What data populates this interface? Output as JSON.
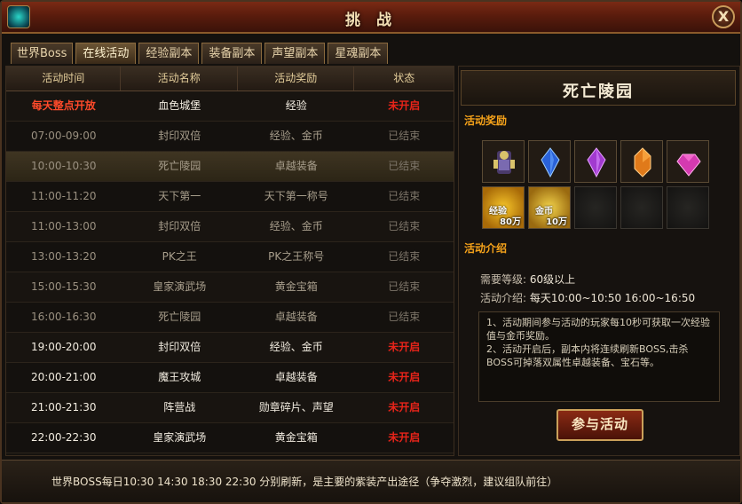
{
  "window": {
    "title": "挑 战",
    "close_label": "X"
  },
  "tabs": [
    {
      "label": "世界Boss",
      "active": false
    },
    {
      "label": "在线活动",
      "active": true
    },
    {
      "label": "经验副本",
      "active": false
    },
    {
      "label": "装备副本",
      "active": false
    },
    {
      "label": "声望副本",
      "active": false
    },
    {
      "label": "星魂副本",
      "active": false
    }
  ],
  "table": {
    "headers": [
      "活动时间",
      "活动名称",
      "活动奖励",
      "状态"
    ],
    "rows": [
      {
        "time": "每天整点开放",
        "name": "血色城堡",
        "reward": "经验",
        "status": "未开启"
      },
      {
        "time": "07:00-09:00",
        "name": "封印双倍",
        "reward": "经验、金币",
        "status": "已结束"
      },
      {
        "time": "10:00-10:30",
        "name": "死亡陵园",
        "reward": "卓越装备",
        "status": "已结束"
      },
      {
        "time": "11:00-11:20",
        "name": "天下第一",
        "reward": "天下第一称号",
        "status": "已结束"
      },
      {
        "time": "11:00-13:00",
        "name": "封印双倍",
        "reward": "经验、金币",
        "status": "已结束"
      },
      {
        "time": "13:00-13:20",
        "name": "PK之王",
        "reward": "PK之王称号",
        "status": "已结束"
      },
      {
        "time": "15:00-15:30",
        "name": "皇家演武场",
        "reward": "黄金宝箱",
        "status": "已结束"
      },
      {
        "time": "16:00-16:30",
        "name": "死亡陵园",
        "reward": "卓越装备",
        "status": "已结束"
      },
      {
        "time": "19:00-20:00",
        "name": "封印双倍",
        "reward": "经验、金币",
        "status": "未开启"
      },
      {
        "time": "20:00-21:00",
        "name": "魔王攻城",
        "reward": "卓越装备",
        "status": "未开启"
      },
      {
        "time": "21:00-21:30",
        "name": "阵营战",
        "reward": "勋章碎片、声望",
        "status": "未开启"
      },
      {
        "time": "22:00-22:30",
        "name": "皇家演武场",
        "reward": "黄金宝箱",
        "status": "未开启"
      }
    ]
  },
  "detail": {
    "title": "死亡陵园",
    "reward_section": "活动奖励",
    "rewards": [
      {
        "icon": "armor-set-icon",
        "color": "#7a6ab0"
      },
      {
        "icon": "blue-crystal-icon",
        "color": "#2a62d8"
      },
      {
        "icon": "purple-crystal-icon",
        "color": "#a23ad0"
      },
      {
        "icon": "orange-crystal-icon",
        "color": "#e07a1a"
      },
      {
        "icon": "pink-gem-icon",
        "color": "#d43ab0"
      },
      {
        "icon": "exp-icon",
        "label": "经验",
        "qty": "80万"
      },
      {
        "icon": "gold-coin-icon",
        "label": "金币",
        "qty": "10万"
      }
    ],
    "intro_section": "活动介绍",
    "level_label": "需要等级:",
    "level_value": "60级以上",
    "intro_label": "活动介绍:",
    "intro_value": "每天10:00~10:50  16:00~16:50",
    "desc_line1": "1、活动期间参与活动的玩家每10秒可获取一次经验值与金币奖励。",
    "desc_line2": "2、活动开启后，副本内将连续刷新BOSS,击杀BOSS可掉落双属性卓越装备、宝石等。",
    "join_label": "参与活动"
  },
  "footer": {
    "text": "世界BOSS每日10:30  14:30  18:30  22:30  分别刷新，是主要的紫装产出途径（争夺激烈，建议组队前往）"
  },
  "colors": {
    "status_open": "#e8241a",
    "section_heading": "#f5a21a",
    "title_bar": "#5a1c0d"
  }
}
